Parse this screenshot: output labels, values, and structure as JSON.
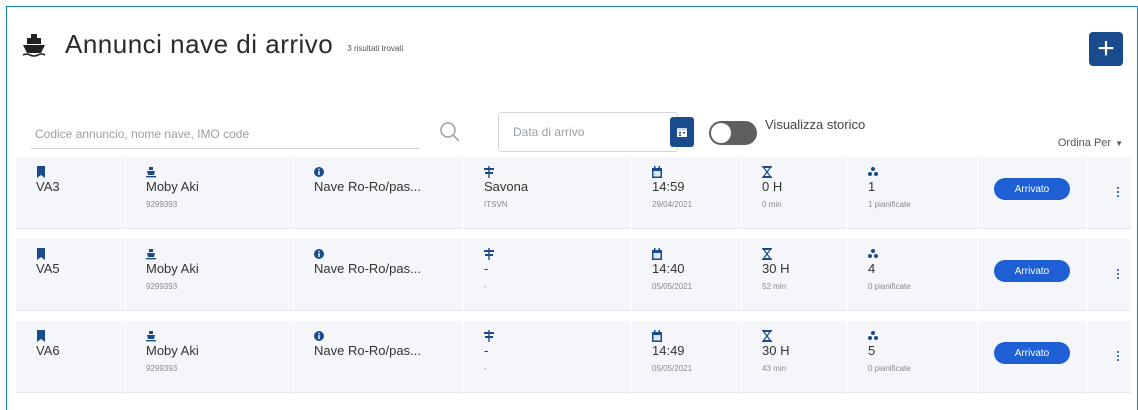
{
  "header": {
    "title": "Annunci nave di arrivo",
    "subtitle": "3 risultati trovati"
  },
  "search": {
    "placeholder": "Codice annuncio, nome nave, IMO code"
  },
  "date_filter": {
    "placeholder": "Data di arrivo"
  },
  "history_toggle": {
    "label": "Visualizza storico",
    "on": false
  },
  "sort": {
    "label": "Ordina Per"
  },
  "colors": {
    "primary": "#1a4b8c",
    "badge": "#1e5fd6",
    "row_bg": "#f4f6fa",
    "frame": "#1e7fc8"
  },
  "rows": [
    {
      "code": "VA3",
      "ship": "Moby Aki",
      "imo": "9299393",
      "type": "Nave Ro-Ro/pas...",
      "port": "Savona",
      "port_code": "ITSVN",
      "time": "14:59",
      "date": "29/04/2021",
      "duration": "0 H",
      "duration_min": "0 min",
      "planned": "1",
      "planned_label": "1 pianificate",
      "status": "Arrivato"
    },
    {
      "code": "VA5",
      "ship": "Moby Aki",
      "imo": "9299393",
      "type": "Nave Ro-Ro/pas...",
      "port": "-",
      "port_code": "-",
      "time": "14:40",
      "date": "05/05/2021",
      "duration": "30 H",
      "duration_min": "52 min",
      "planned": "4",
      "planned_label": "0 pianificate",
      "status": "Arrivato"
    },
    {
      "code": "VA6",
      "ship": "Moby Aki",
      "imo": "9299393",
      "type": "Nave Ro-Ro/pas...",
      "port": "-",
      "port_code": "-",
      "time": "14:49",
      "date": "05/05/2021",
      "duration": "30 H",
      "duration_min": "43 min",
      "planned": "5",
      "planned_label": "0 pianificate",
      "status": "Arrivato"
    }
  ]
}
